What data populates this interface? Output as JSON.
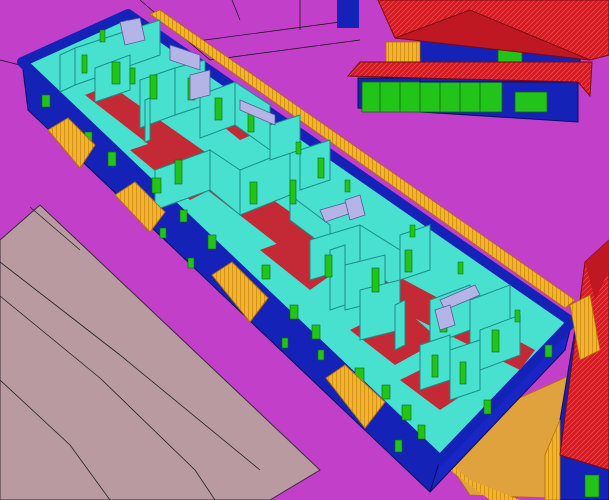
{
  "colors": {
    "ground": "#c13fc9",
    "road": "#b99aa0",
    "exterior_wall": "#1422b8",
    "interior_wall": "#48e0cf",
    "floor": "#c42a35",
    "window": "#22c41a",
    "balcony": "#f0c234",
    "railing": "#e89a1c",
    "roof": "#d61b24",
    "counter": "#b4b4e6",
    "outline": "#101010"
  },
  "scene": {
    "view": "isometric-cutaway",
    "main_building": "cutaway-apartment-block",
    "neighbors": [
      "house-top-right",
      "house-right-edge"
    ]
  }
}
